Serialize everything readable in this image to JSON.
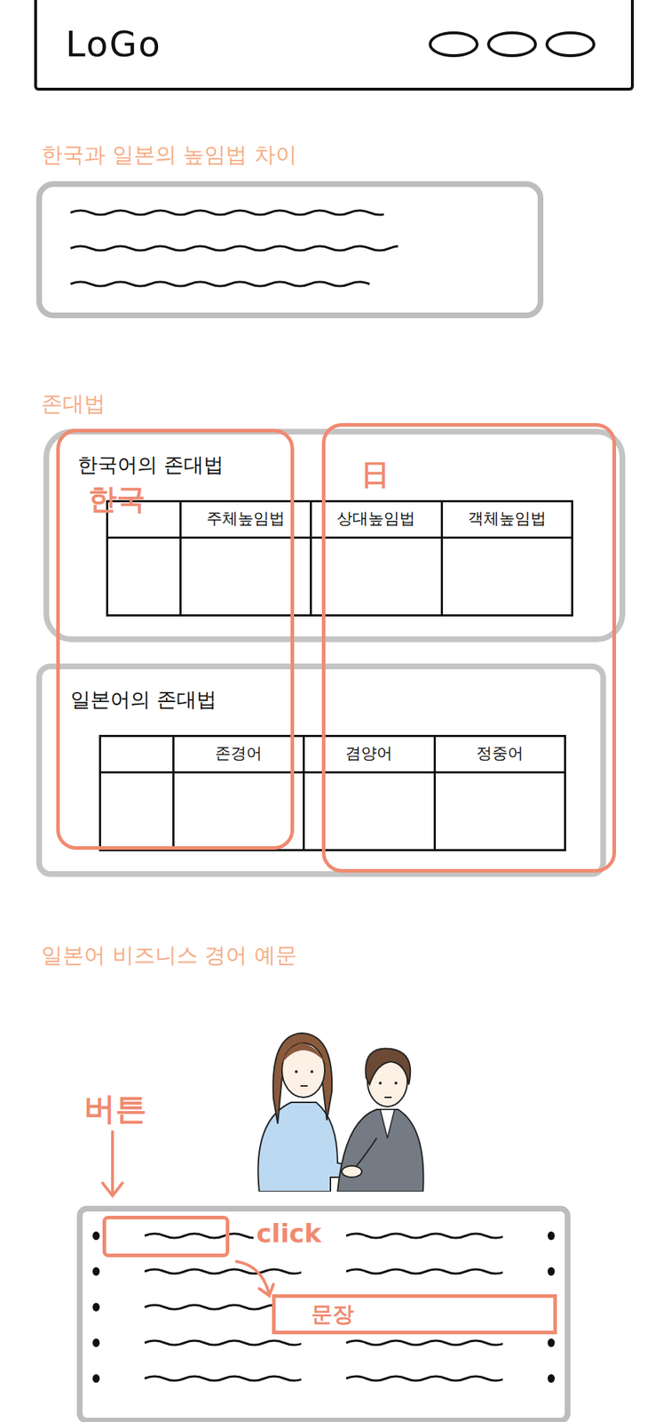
{
  "header": {
    "logo": "LoGo"
  },
  "difference": {
    "title": "한국과 일본의 높임법 차이"
  },
  "honorifics": {
    "title": "존대법",
    "tables": [
      {
        "title": "한국어의 존대법",
        "columns": [
          "",
          "주체높임법",
          "상대높임법",
          "객체높임법"
        ]
      },
      {
        "title": "일본어의 존대법",
        "columns": [
          "",
          "존경어",
          "겸양어",
          "정중어"
        ]
      }
    ],
    "annotations": [
      {
        "label": "한국"
      },
      {
        "label": "日"
      }
    ]
  },
  "examples": {
    "title": "일본어 비즈니스 경어 예문",
    "button_note": "버튼",
    "click_note": "click",
    "sentence_label": "문장"
  }
}
